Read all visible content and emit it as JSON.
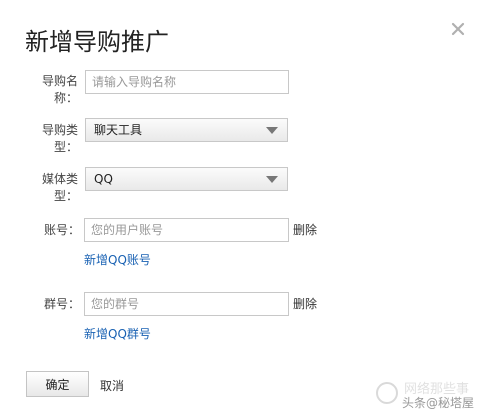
{
  "dialog": {
    "title": "新增导购推广",
    "close_icon": "close-icon"
  },
  "form": {
    "name_label_line1": "导购名",
    "name_label_line2": "称：",
    "name_placeholder": "请输入导购名称",
    "type_label_line1": "导购类",
    "type_label_line2": "型：",
    "type_selected": "聊天工具",
    "media_label_line1": "媒体类",
    "media_label_line2": "型：",
    "media_selected": "QQ",
    "account_label": "账号：",
    "account_placeholder": "您的用户账号",
    "account_delete": "删除",
    "add_account_link": "新增QQ账号",
    "group_label": "群号：",
    "group_placeholder": "您的群号",
    "group_delete": "删除",
    "add_group_link": "新增QQ群号"
  },
  "footer": {
    "confirm_label": "确定",
    "cancel_label": "取消"
  },
  "watermark": {
    "top_text": "网络那些事",
    "bottom_text": "头条@秘塔屋"
  },
  "colors": {
    "link": "#1a62b3",
    "input_border": "#c8c8c8",
    "placeholder": "#999999"
  }
}
